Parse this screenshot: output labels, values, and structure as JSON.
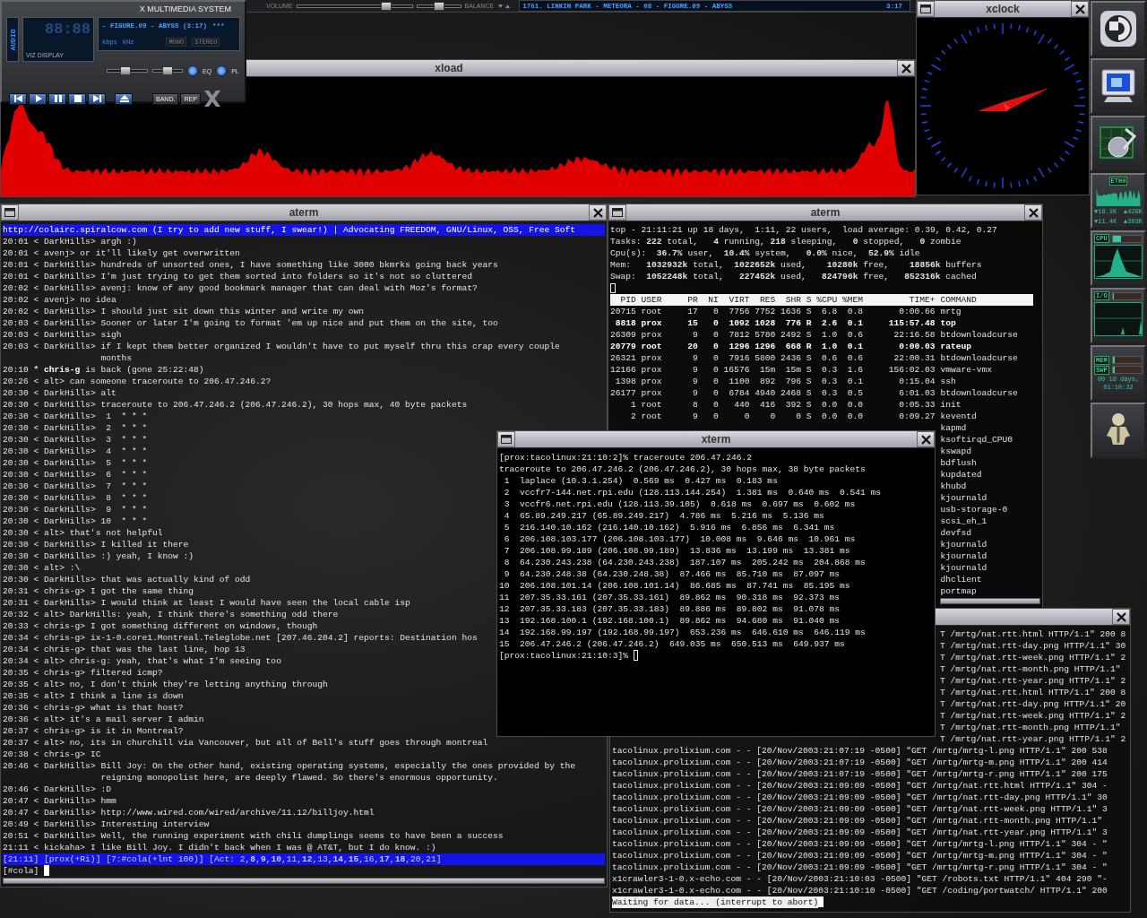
{
  "media_player": {
    "title": "X MULTIMEDIA SYSTEM",
    "side_label": "AUDIO",
    "time": "88:88",
    "viz_label": "VIZ DISPLAY",
    "track": "- FIGURE.09 - ABYSS (3:17)",
    "track_marker": "***",
    "bitrate_label": "kbps",
    "rate_label": "kHz",
    "modes": [
      {
        "label": "MONO",
        "on": false
      },
      {
        "label": "STEREO",
        "on": false
      }
    ],
    "sliders": [
      {
        "kind": "volume",
        "level": 0.45
      },
      {
        "kind": "balance",
        "level": 0.5
      }
    ],
    "toggles": [
      {
        "label": "EQ",
        "on": true
      },
      {
        "label": "PL",
        "on": true
      }
    ],
    "buttons": [
      "BAND.",
      "REP"
    ]
  },
  "playlist_bar": {
    "volume_label": "VOLUME",
    "volume": {
      "level": 0.78
    },
    "balance": {
      "level": 0.5
    },
    "balance_label": "BALANCE",
    "now_playing": "1761. LINKIN PARK - METEORA - 08 - FIGURE.09 - ABYSS",
    "time": "3:17"
  },
  "xload": {
    "title": "xload"
  },
  "xclock": {
    "title": "xclock"
  },
  "dock": {
    "net": {
      "label": "ETH0",
      "readings": [
        "▼18.1K",
        "▲429K",
        "▼11.4K",
        "▲303K"
      ]
    },
    "meters": [
      {
        "label": "CPU",
        "level": 0.3
      },
      {
        "label": "I/O",
        "level": 0.03
      },
      {
        "label": "MEM",
        "level": 0.06
      },
      {
        "label": "SWP",
        "level": 0.06
      }
    ],
    "uptime": [
      "00 18 days,",
      "01:10:32"
    ]
  },
  "irc": {
    "title": "aterm",
    "topic": "http://colairc.spiralcow.com (I try to add new stuff, I swear!) | Advocating FREEDOM, GNU/Linux, OSS, Free Soft",
    "messages": [
      {
        "time": "20:01",
        "kind": "msg",
        "from": "< DarkHills>",
        "text": "argh :)"
      },
      {
        "time": "20:01",
        "kind": "msg",
        "from": "< avenj>",
        "text": "or it'll likely get overwritten"
      },
      {
        "time": "20:01",
        "kind": "msg",
        "from": "< DarkHills>",
        "text": "hundreds of unsorted ones, I have something like 3000 bkmrks going back years"
      },
      {
        "time": "20:01",
        "kind": "msg",
        "from": "< DarkHills>",
        "text": "I'm just trying to get them sorted into folders so it's not so cluttered"
      },
      {
        "time": "20:02",
        "kind": "msg",
        "from": "< DarkHills>",
        "text": "avenj: know of any good bookmark manager that can deal with Moz's format?"
      },
      {
        "time": "20:02",
        "kind": "msg",
        "from": "< avenj>",
        "text": "no idea"
      },
      {
        "time": "20:02",
        "kind": "msg",
        "from": "< DarkHills>",
        "text": "I should just sit down this winter and write my own"
      },
      {
        "time": "20:03",
        "kind": "msg",
        "from": "< DarkHills>",
        "text": "Sooner or later I'm going to format 'em up nice and put them on the site, too"
      },
      {
        "time": "20:03",
        "kind": "msg",
        "from": "< DarkHills>",
        "text": "sigh"
      },
      {
        "time": "20:03",
        "kind": "msg",
        "from": "< DarkHills>",
        "text": "if I kept them better organized I wouldn't have to put myself thru this crap every couple",
        "continued": "months"
      },
      {
        "time": "20:10",
        "kind": "action",
        "from": "*",
        "nick": "chris-g",
        "text": "is back (gone 25:22:48)"
      },
      {
        "time": "20:26",
        "kind": "msg",
        "from": "< alt>",
        "text": "can someone traceroute to 206.47.246.2?"
      },
      {
        "time": "20:30",
        "kind": "msg",
        "from": "< DarkHills>",
        "text": "alt"
      },
      {
        "time": "20:30",
        "kind": "msg",
        "from": "< DarkHills>",
        "text": "traceroute to 206.47.246.2 (206.47.246.2), 30 hops max, 40 byte packets"
      },
      {
        "time": "20:30",
        "kind": "msg",
        "from": "< DarkHills>",
        "text": " 1  * * *"
      },
      {
        "time": "20:30",
        "kind": "msg",
        "from": "< DarkHills>",
        "text": " 2  * * *"
      },
      {
        "time": "20:30",
        "kind": "msg",
        "from": "< DarkHills>",
        "text": " 3  * * *"
      },
      {
        "time": "20:30",
        "kind": "msg",
        "from": "< DarkHills>",
        "text": " 4  * * *"
      },
      {
        "time": "20:30",
        "kind": "msg",
        "from": "< DarkHills>",
        "text": " 5  * * *"
      },
      {
        "time": "20:30",
        "kind": "msg",
        "from": "< DarkHills>",
        "text": " 6  * * *"
      },
      {
        "time": "20:30",
        "kind": "msg",
        "from": "< DarkHills>",
        "text": " 7  * * *"
      },
      {
        "time": "20:30",
        "kind": "msg",
        "from": "< DarkHills>",
        "text": " 8  * * *"
      },
      {
        "time": "20:30",
        "kind": "msg",
        "from": "< DarkHills>",
        "text": " 9  * * *"
      },
      {
        "time": "20:30",
        "kind": "msg",
        "from": "< DarkHills>",
        "text": "10  * * *"
      },
      {
        "time": "20:30",
        "kind": "msg",
        "from": "< alt>",
        "text": "that's not helpful"
      },
      {
        "time": "20:30",
        "kind": "msg",
        "from": "< DarkHills>",
        "text": "I killed it there"
      },
      {
        "time": "20:30",
        "kind": "msg",
        "from": "< DarkHills>",
        "text": ":) yeah, I know :)"
      },
      {
        "time": "20:30",
        "kind": "msg",
        "from": "< alt>",
        "text": ":\\"
      },
      {
        "time": "20:30",
        "kind": "msg",
        "from": "< DarkHills>",
        "text": "that was actually kind of odd"
      },
      {
        "time": "20:31",
        "kind": "msg",
        "from": "< chris-g>",
        "text": "I got the same thing"
      },
      {
        "time": "20:31",
        "kind": "msg",
        "from": "< DarkHills>",
        "text": "I would think at least I would have seen the local cable isp"
      },
      {
        "time": "20:32",
        "kind": "msg",
        "from": "< alt>",
        "text": "DarkHills: yeah, I think there's something odd there"
      },
      {
        "time": "20:33",
        "kind": "msg",
        "from": "< chris-g>",
        "text": "I got something different on windows, though"
      },
      {
        "time": "20:34",
        "kind": "msg",
        "from": "< chris-g>",
        "text": "ix-1-0.core1.Montreal.Teleglobe.net [207.46.204.2] reports: Destination hos"
      },
      {
        "time": "20:34",
        "kind": "msg",
        "from": "< chris-g>",
        "text": "that was the last line, hop 13"
      },
      {
        "time": "20:34",
        "kind": "msg",
        "from": "< alt>",
        "text": "chris-g: yeah, that's what I'm seeing too"
      },
      {
        "time": "20:35",
        "kind": "msg",
        "from": "< chris-g>",
        "text": "filtered icmp?"
      },
      {
        "time": "20:35",
        "kind": "msg",
        "from": "< alt>",
        "text": "no, I don't think they're letting anything through"
      },
      {
        "time": "20:35",
        "kind": "msg",
        "from": "< alt>",
        "text": "I think a line is down"
      },
      {
        "time": "20:36",
        "kind": "msg",
        "from": "< chris-g>",
        "text": "what is that host?"
      },
      {
        "time": "20:36",
        "kind": "msg",
        "from": "< alt>",
        "text": "it's a mail server I admin"
      },
      {
        "time": "20:37",
        "kind": "msg",
        "from": "< chris-g>",
        "text": "is it in Montreal?"
      },
      {
        "time": "20:37",
        "kind": "msg",
        "from": "< alt>",
        "text": "no, its in churchill via Vancouver, but all of Bell's stuff goes through montreal"
      },
      {
        "time": "20:38",
        "kind": "msg",
        "from": "< chris-g>",
        "text": "IC"
      },
      {
        "time": "20:46",
        "kind": "msg",
        "from": "< DarkHills>",
        "text": "Bill Joy: On the other hand, existing operating systems, especially the ones provided by the",
        "continued": "reigning monopolist here, are deeply flawed. So there's enormous opportunity."
      },
      {
        "time": "20:46",
        "kind": "msg",
        "from": "< DarkHills>",
        "text": ":D"
      },
      {
        "time": "20:47",
        "kind": "msg",
        "from": "< DarkHills>",
        "text": "hmm"
      },
      {
        "time": "20:47",
        "kind": "msg",
        "from": "< DarkHills>",
        "text": "http://www.wired.com/wired/archive/11.12/billjoy.html"
      },
      {
        "time": "20:49",
        "kind": "msg",
        "from": "< DarkHills>",
        "text": "Interesting interview"
      },
      {
        "time": "20:51",
        "kind": "msg",
        "from": "< DarkHills>",
        "text": "Well, the running experiment with chili dumplings seems to have been a success"
      },
      {
        "time": "21:11",
        "kind": "msg",
        "from": "< kickaha>",
        "text": "I like Bill Joy. I didn't back when I was @ AT&T, but I do know. :)"
      }
    ],
    "status": "[21:11] [prox(+Ri)] [7:#cola(+lnt 100)] [Act: 2,**8**,**9**,**10**,11,**12**,13,**14**,**15**,16,**17**,**18**,20,21]",
    "prompt": "[#cola]"
  },
  "top": {
    "title": "aterm",
    "summary": [
      "top - 21:11:21 up 18 days,  1:11, 22 users,  load average: 0.39, 0.42, 0.27",
      "Tasks: **222** total,   **4** running, **218** sleeping,   **0** stopped,   **0** zombie",
      "Cpu(s):  **36.7%** user,  **10.4%** system,   **0.0%** nice,  **52.9%** idle",
      "Mem:   **1032932k** total,  **1022652k** used,    **10280k** free,    **18856k** buffers",
      "Swap:  **1052248k** total,   **227452k** used,   **824796k** free,   **852316k** cached"
    ],
    "columns": [
      "PID",
      "USER",
      "PR",
      "NI",
      "VIRT",
      "RES",
      "SHR",
      "S",
      "%CPU",
      "%MEM",
      "TIME+",
      "COMMAND"
    ],
    "rows": [
      {
        "kind": "process",
        "bold": false,
        "cells": [
          "20715",
          "root",
          "17",
          "0",
          "7756",
          "7752",
          "1636",
          "S",
          "6.8",
          "0.8",
          "0:00.66",
          "mrtg"
        ]
      },
      {
        "kind": "process",
        "bold": true,
        "cells": [
          "8818",
          "prox",
          "15",
          "0",
          "1092",
          "1028",
          "776",
          "R",
          "2.6",
          "0.1",
          "115:57.48",
          "top"
        ]
      },
      {
        "kind": "process",
        "bold": false,
        "cells": [
          "26309",
          "prox",
          "9",
          "0",
          "7812",
          "5780",
          "2492",
          "S",
          "1.0",
          "0.6",
          "22:16.58",
          "btdownloadcurse"
        ]
      },
      {
        "kind": "process",
        "bold": true,
        "cells": [
          "20779",
          "root",
          "20",
          "0",
          "1296",
          "1296",
          "668",
          "R",
          "1.0",
          "0.1",
          "0:00.03",
          "rateup"
        ]
      },
      {
        "kind": "process",
        "bold": false,
        "cells": [
          "26321",
          "prox",
          "9",
          "0",
          "7916",
          "5800",
          "2436",
          "S",
          "0.6",
          "0.6",
          "22:00.31",
          "btdownloadcurse"
        ]
      },
      {
        "kind": "process",
        "bold": false,
        "cells": [
          "12166",
          "prox",
          "9",
          "0",
          "16576",
          "15m",
          "15m",
          "S",
          "0.3",
          "1.6",
          "156:02.03",
          "vmware-vmx"
        ]
      },
      {
        "kind": "process",
        "bold": false,
        "cells": [
          "1398",
          "prox",
          "9",
          "0",
          "1100",
          "892",
          "796",
          "S",
          "0.3",
          "0.1",
          "0:15.04",
          "ssh"
        ]
      },
      {
        "kind": "process",
        "bold": false,
        "cells": [
          "26177",
          "prox",
          "9",
          "0",
          "6784",
          "4940",
          "2468",
          "S",
          "0.3",
          "0.5",
          "6:01.03",
          "btdownloadcurse"
        ]
      },
      {
        "kind": "process",
        "bold": false,
        "cells": [
          "1",
          "root",
          "8",
          "0",
          "440",
          "416",
          "392",
          "S",
          "0.0",
          "0.0",
          "0:05.33",
          "init"
        ]
      },
      {
        "kind": "process",
        "bold": false,
        "cells": [
          "2",
          "root",
          "9",
          "0",
          "0",
          "0",
          "0",
          "S",
          "0.0",
          "0.0",
          "0:09.27",
          "keventd"
        ]
      },
      {
        "kind": "covered",
        "cells": [
          "kapmd"
        ]
      },
      {
        "kind": "covered",
        "cells": [
          "ksoftirqd_CPU0"
        ]
      },
      {
        "kind": "covered",
        "cells": [
          "kswapd"
        ]
      },
      {
        "kind": "covered",
        "cells": [
          "bdflush"
        ]
      },
      {
        "kind": "covered",
        "cells": [
          "kupdated"
        ]
      },
      {
        "kind": "covered",
        "cells": [
          "khubd"
        ]
      },
      {
        "kind": "covered",
        "cells": [
          "kjournald"
        ]
      },
      {
        "kind": "covered",
        "cells": [
          "usb-storage-0"
        ]
      },
      {
        "kind": "covered",
        "cells": [
          "scsi_eh_1"
        ]
      },
      {
        "kind": "covered",
        "cells": [
          "devfsd"
        ]
      },
      {
        "kind": "covered",
        "cells": [
          "kjournald"
        ]
      },
      {
        "kind": "covered",
        "cells": [
          "kjournald"
        ]
      },
      {
        "kind": "covered",
        "cells": [
          "kjournald"
        ]
      },
      {
        "kind": "covered",
        "cells": [
          "dhclient"
        ]
      },
      {
        "kind": "covered",
        "cells": [
          "portmap"
        ]
      }
    ]
  },
  "xterm": {
    "title": "xterm",
    "lines": [
      "[prox:tacolinux:21:10:2]% traceroute 206.47.246.2",
      "traceroute to 206.47.246.2 (206.47.246.2), 30 hops max, 38 byte packets",
      " 1  laplace (10.3.1.254)  0.569 ms  0.427 ms  0.183 ms",
      " 2  vccfr7-144.net.rpi.edu (128.113.144.254)  1.381 ms  0.640 ms  0.541 ms",
      " 3  vccfr6.net.rpi.edu (128.113.39.105)  0.618 ms  0.697 ms  0.602 ms",
      " 4  65.89.249.217 (65.89.249.217)  4.786 ms  5.216 ms  5.136 ms",
      " 5  216.140.10.162 (216.140.10.162)  5.916 ms  6.856 ms  6.341 ms",
      " 6  206.108.103.177 (206.108.103.177)  10.008 ms  9.646 ms  10.961 ms",
      " 7  206.108.99.189 (206.108.99.189)  13.836 ms  13.199 ms  13.381 ms",
      " 8  64.230.243.238 (64.230.243.238)  187.107 ms  205.242 ms  204.868 ms",
      " 9  64.230.248.38 (64.230.248.38)  87.466 ms  85.710 ms  87.097 ms",
      "10  206.108.101.14 (206.108.101.14)  86.685 ms  87.741 ms  85.195 ms",
      "11  207.35.33.161 (207.35.33.161)  89.862 ms  90.318 ms  92.373 ms",
      "12  207.35.33.183 (207.35.33.183)  89.886 ms  89.802 ms  91.078 ms",
      "13  192.168.100.1 (192.168.100.1)  89.862 ms  94.680 ms  91.040 ms",
      "14  192.168.99.197 (192.168.99.197)  653.236 ms  646.610 ms  646.119 ms",
      "15  206.47.246.2 (206.47.246.2)  649.035 ms  650.513 ms  649.937 ms"
    ],
    "prompt": "[prox:tacolinux:21:10:3]%"
  },
  "log": {
    "partial_lines": [
      "T /mrtg/nat.rtt.html HTTP/1.1\" 200 8",
      "T /mrtg/nat.rtt-day.png HTTP/1.1\" 30",
      "T /mrtg/nat.rtt-week.png HTTP/1.1\" 2",
      "T /mrtg/nat.rtt-month.png HTTP/1.1\"",
      "T /mrtg/nat.rtt-year.png HTTP/1.1\" 2",
      "T /mrtg/nat.rtt.html HTTP/1.1\" 200 8",
      "T /mrtg/nat.rtt-day.png HTTP/1.1\" 20",
      "T /mrtg/nat.rtt-week.png HTTP/1.1\" 2",
      "T /mrtg/nat.rtt-month.png HTTP/1.1\"",
      "T /mrtg/nat.rtt-year.png HTTP/1.1\" 2"
    ],
    "lines": [
      "tacolinux.prolixium.com - - [20/Nov/2003:21:07:19 -0500] \"GET /mrtg/mrtg-l.png HTTP/1.1\" 200 538",
      "tacolinux.prolixium.com - - [20/Nov/2003:21:07:19 -0500] \"GET /mrtg/mrtg-m.png HTTP/1.1\" 200 414",
      "tacolinux.prolixium.com - - [20/Nov/2003:21:07:19 -0500] \"GET /mrtg/mrtg-r.png HTTP/1.1\" 200 175",
      "tacolinux.prolixium.com - - [20/Nov/2003:21:09:09 -0500] \"GET /mrtg/nat.rtt.html HTTP/1.1\" 304 -",
      "tacolinux.prolixium.com - - [20/Nov/2003:21:09:09 -0500] \"GET /mrtg/nat.rtt-day.png HTTP/1.1\" 30",
      "tacolinux.prolixium.com - - [20/Nov/2003:21:09:09 -0500] \"GET /mrtg/nat.rtt-week.png HTTP/1.1\" 3",
      "tacolinux.prolixium.com - - [20/Nov/2003:21:09:09 -0500] \"GET /mrtg/nat.rtt-month.png HTTP/1.1\"",
      "tacolinux.prolixium.com - - [20/Nov/2003:21:09:09 -0500] \"GET /mrtg/nat.rtt-year.png HTTP/1.1\" 3",
      "tacolinux.prolixium.com - - [20/Nov/2003:21:09:09 -0500] \"GET /mrtg/mrtg-l.png HTTP/1.1\" 304 - \"",
      "tacolinux.prolixium.com - - [20/Nov/2003:21:09:09 -0500] \"GET /mrtg/mrtg-m.png HTTP/1.1\" 304 - \"",
      "tacolinux.prolixium.com - - [20/Nov/2003:21:09:09 -0500] \"GET /mrtg/mrtg-r.png HTTP/1.1\" 304 - \"",
      "x1crawler3-1-0.x-echo.com - - [20/Nov/2003:21:10:03 -0500] \"GET /robots.txt HTTP/1.1\" 404 290 \"-",
      "x1crawler3-1-0.x-echo.com - - [20/Nov/2003:21:10:10 -0500] \"GET /coding/portwatch/ HTTP/1.1\" 200"
    ],
    "status": "Waiting for data... (interrupt to abort)"
  }
}
